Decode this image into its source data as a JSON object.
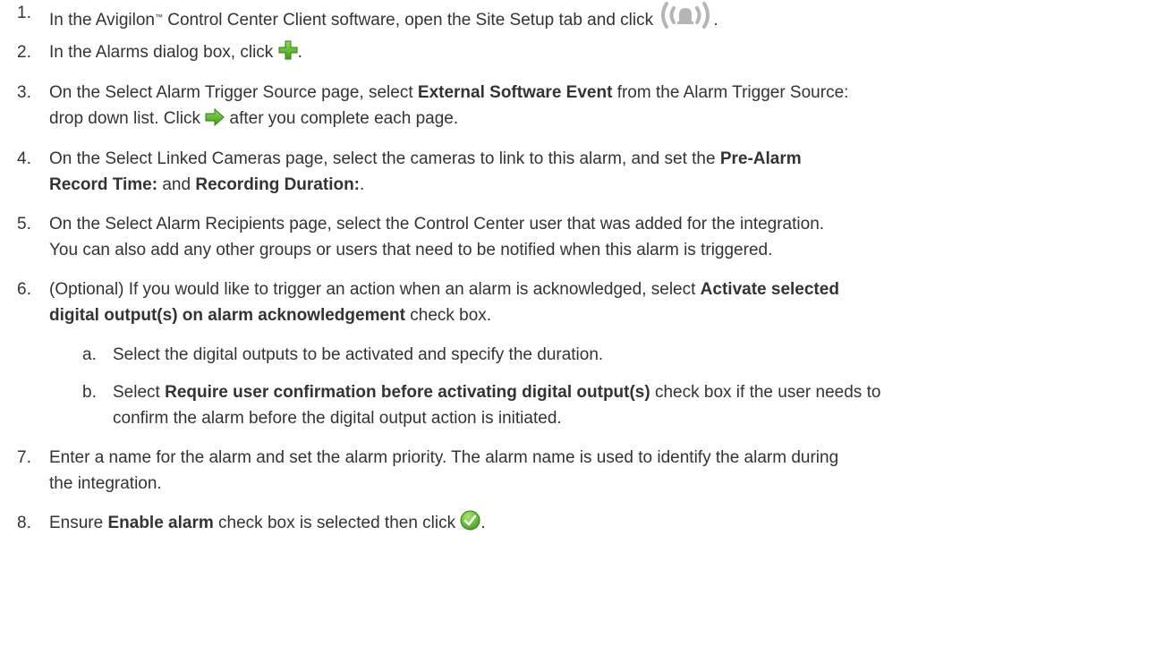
{
  "steps": [
    {
      "num": "1.",
      "text_a": "In the Avigilon",
      "tm": "™",
      "text_b": " Control Center Client software, open the Site Setup tab and click ",
      "text_c": ".",
      "icon": "alarm-bell-icon"
    },
    {
      "num": "2.",
      "text_a": "In the Alarms dialog box, click ",
      "text_b": ".",
      "icon": "green-plus-icon"
    },
    {
      "num": "3.",
      "text_a": "On the Select Alarm Trigger Source page, select ",
      "bold_a": "External Software Event",
      "text_b": " from the Alarm Trigger Source:",
      "text_c": "drop down list. Click ",
      "text_d": " after you complete each page.",
      "icon": "green-arrow-right-icon"
    },
    {
      "num": "4.",
      "text_a": "On the Select Linked Cameras page, select the cameras to link to this alarm, and set the ",
      "bold_a": "Pre-Alarm",
      "bold_b": "Record Time:",
      "text_b": " and ",
      "bold_c": "Recording Duration:",
      "text_c": "."
    },
    {
      "num": "5.",
      "line_1": "On the Select Alarm Recipients page, select the Control Center user that was added for the integration.",
      "line_2": "You can also add any other groups or users that need to be notified when this alarm is triggered."
    },
    {
      "num": "6.",
      "text_a": "(Optional) If you would like to trigger an action when an alarm is acknowledged, select ",
      "bold_a": "Activate selected",
      "bold_b": "digital output(s) on alarm acknowledgement",
      "text_b": " check box."
    },
    {
      "num": "7.",
      "line_1": "Enter a name for the alarm and set the alarm priority. The alarm name is used to identify the alarm during",
      "line_2": "the integration."
    },
    {
      "num": "8.",
      "text_a": "Ensure ",
      "bold_a": "Enable alarm",
      "text_b": " check box is selected then click ",
      "text_c": ".",
      "icon": "green-check-circle-icon"
    }
  ],
  "substeps": [
    {
      "num": "a.",
      "text": "Select the digital outputs to be activated and specify the duration."
    },
    {
      "num": "b.",
      "text_a": "Select ",
      "bold_a": "Require user confirmation before activating digital output(s)",
      "text_b": " check box if the user needs to",
      "text_c": "confirm the alarm before the digital output action is initiated."
    }
  ]
}
